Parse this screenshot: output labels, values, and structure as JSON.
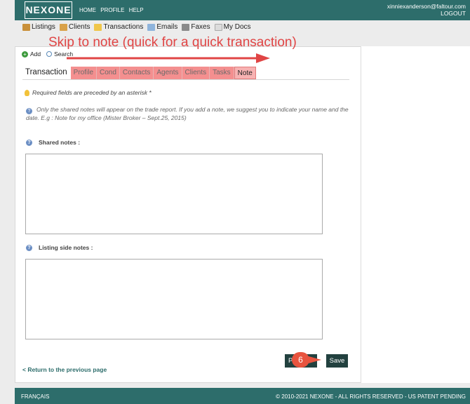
{
  "header": {
    "logo": "NEXONE",
    "nav": [
      "HOME",
      "PROFILE",
      "HELP"
    ],
    "user_email": "xinniexanderson@faltour.com",
    "logout": "LOGOUT"
  },
  "menu": [
    {
      "label": "Listings",
      "icon": "house-icon"
    },
    {
      "label": "Clients",
      "icon": "person-icon"
    },
    {
      "label": "Transactions",
      "icon": "folder-icon"
    },
    {
      "label": "Emails",
      "icon": "envelope-icon"
    },
    {
      "label": "Faxes",
      "icon": "fax-icon"
    },
    {
      "label": "My Docs",
      "icon": "docs-icon"
    }
  ],
  "actions": {
    "add": "Add",
    "search": "Search"
  },
  "annotation": {
    "text": "Skip to note (quick for a quick transaction)",
    "color": "#e04545"
  },
  "tabs": {
    "active": "Transaction",
    "items": [
      "Profile",
      "Cond",
      "Contacts",
      "Agents",
      "Clients",
      "Tasks",
      "Note"
    ]
  },
  "form": {
    "required_note": "Required fields are preceded by an asterisk *",
    "info_note": "Only the shared notes will appear on the trade report. If you add a note, we suggest you to indicate your name and the date. E.g : Note for my office (Mister Broker – Sept.25, 2015)",
    "shared_label": "Shared notes :",
    "shared_value": "",
    "listing_label": "Listing side notes :",
    "listing_value": ""
  },
  "bottom": {
    "back_link": "< Return to the previous page",
    "prev_button": "P",
    "save_button": "Save",
    "step_number": "6"
  },
  "footer": {
    "language": "FRANÇAIS",
    "copyright": "© 2010-2021 NEXONE - ALL RIGHTS RESERVED - US PATENT PENDING"
  },
  "colors": {
    "brand": "#2d6d6b",
    "tab": "#f48f8f",
    "button": "#22413f",
    "step": "#e8543f"
  }
}
